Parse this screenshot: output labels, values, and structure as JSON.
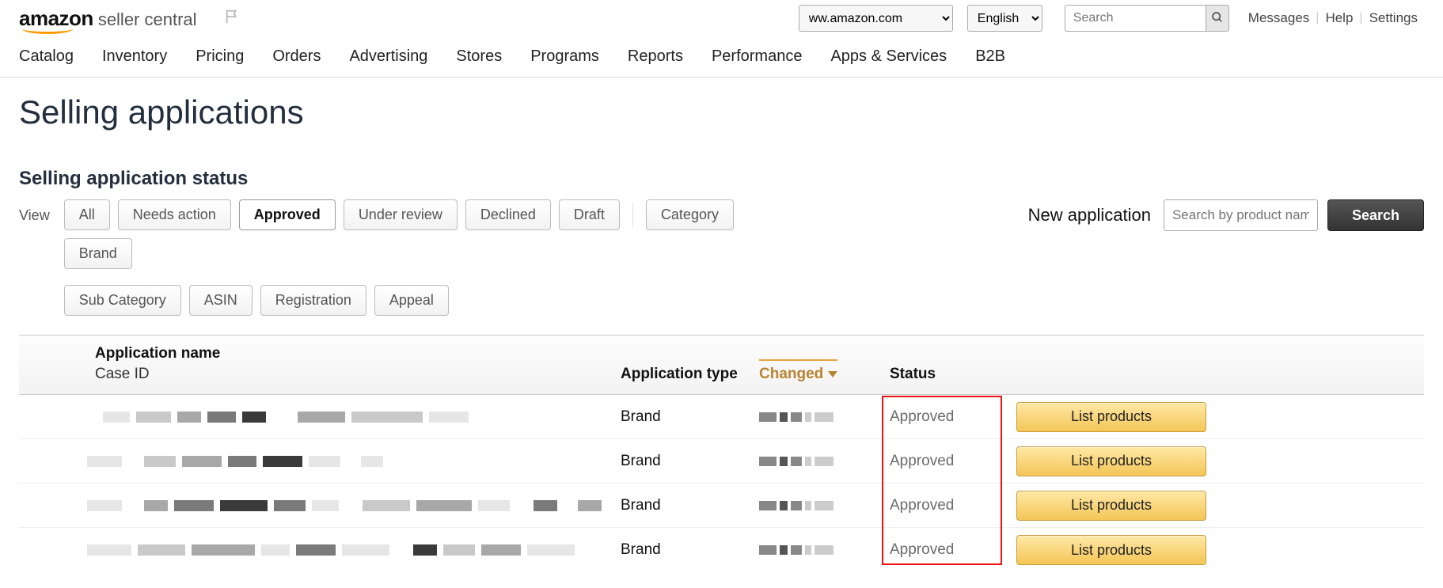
{
  "header": {
    "logo_main": "amazon",
    "logo_sub": "seller central",
    "marketplace_value": "ww.amazon.com",
    "language_value": "English",
    "search_placeholder": "Search",
    "links": {
      "messages": "Messages",
      "help": "Help",
      "settings": "Settings"
    }
  },
  "nav": [
    "Catalog",
    "Inventory",
    "Pricing",
    "Orders",
    "Advertising",
    "Stores",
    "Programs",
    "Reports",
    "Performance",
    "Apps & Services",
    "B2B"
  ],
  "page": {
    "title": "Selling applications",
    "section_title": "Selling application status",
    "view_label": "View",
    "filters_primary": [
      "All",
      "Needs action",
      "Approved",
      "Under review",
      "Declined",
      "Draft"
    ],
    "filters_secondary_row1": [
      "Category",
      "Brand"
    ],
    "filters_secondary_row2": [
      "Sub Category",
      "ASIN",
      "Registration",
      "Appeal"
    ],
    "active_filter": "Approved",
    "new_application": {
      "label": "New application",
      "input_placeholder": "Search by product name or ASIN",
      "search_button": "Search"
    }
  },
  "table": {
    "headers": {
      "name": "Application name",
      "name_sub": "Case ID",
      "type": "Application type",
      "changed": "Changed",
      "status": "Status"
    },
    "rows": [
      {
        "type": "Brand",
        "status": "Approved",
        "action": "List products"
      },
      {
        "type": "Brand",
        "status": "Approved",
        "action": "List products"
      },
      {
        "type": "Brand",
        "status": "Approved",
        "action": "List products"
      },
      {
        "type": "Brand",
        "status": "Approved",
        "action": "List products"
      }
    ]
  }
}
